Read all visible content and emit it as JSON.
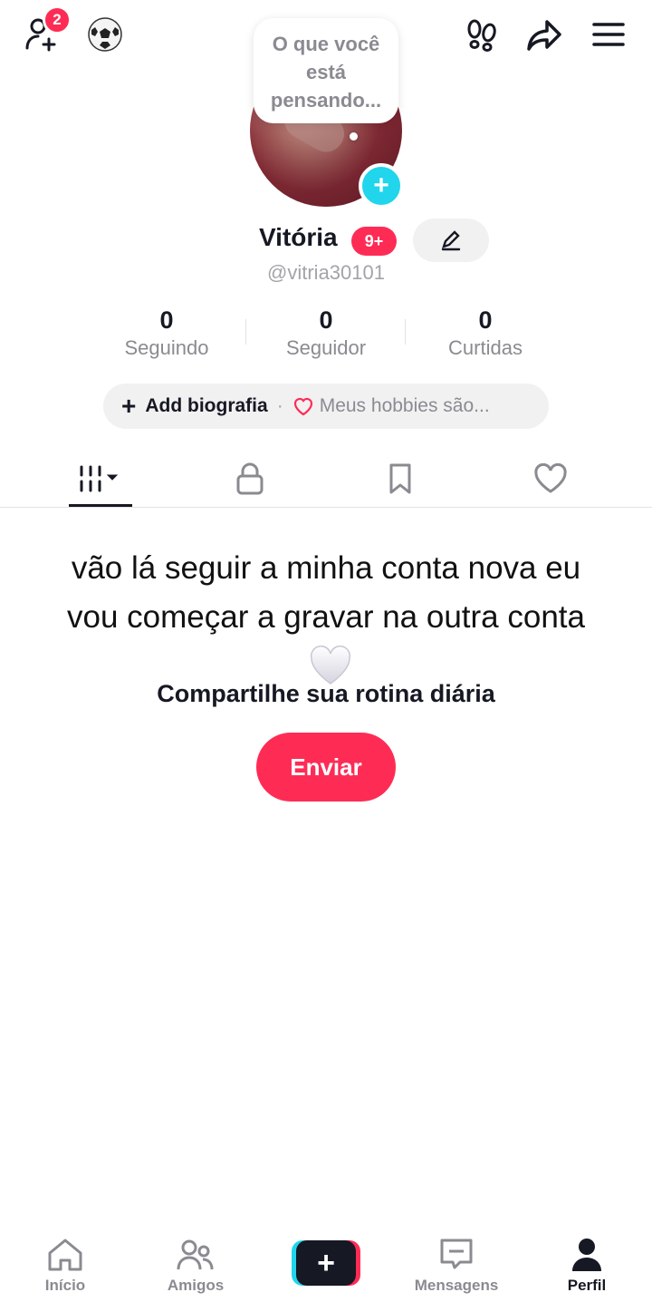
{
  "topbar": {
    "friend_requests_badge": "2",
    "icons": [
      "add-friend-icon",
      "soccer-ball-icon",
      "footprints-icon",
      "share-icon",
      "menu-icon"
    ]
  },
  "profile": {
    "thought_bubble": "O que você está pensando...",
    "name": "Vitória",
    "name_badge": "9+",
    "handle": "@vitria30101"
  },
  "stats": [
    {
      "value": "0",
      "label": "Seguindo"
    },
    {
      "value": "0",
      "label": "Seguidor"
    },
    {
      "value": "0",
      "label": "Curtidas"
    }
  ],
  "bio": {
    "add_label": "Add biografia",
    "separator": "·",
    "hobbies_placeholder": "Meus hobbies são..."
  },
  "tabs": [
    "videos-grid-icon",
    "lock-icon",
    "bookmark-icon",
    "heart-icon"
  ],
  "content": {
    "caption_line1": "vão lá seguir a minha conta nova eu",
    "caption_line2": "vou começar a gravar na outra conta",
    "share_prompt": "Compartilhe sua rotina diária",
    "send_button": "Enviar"
  },
  "bottom_nav": [
    {
      "label": "Início",
      "icon": "home-icon"
    },
    {
      "label": "Amigos",
      "icon": "friends-icon"
    },
    {
      "label": "",
      "icon": "create-icon"
    },
    {
      "label": "Mensagens",
      "icon": "messages-icon"
    },
    {
      "label": "Perfil",
      "icon": "profile-icon",
      "active": true
    }
  ],
  "colors": {
    "accent": "#fe2c55",
    "cyan": "#20d5ec",
    "text": "#161823",
    "muted": "#8a8b91"
  }
}
